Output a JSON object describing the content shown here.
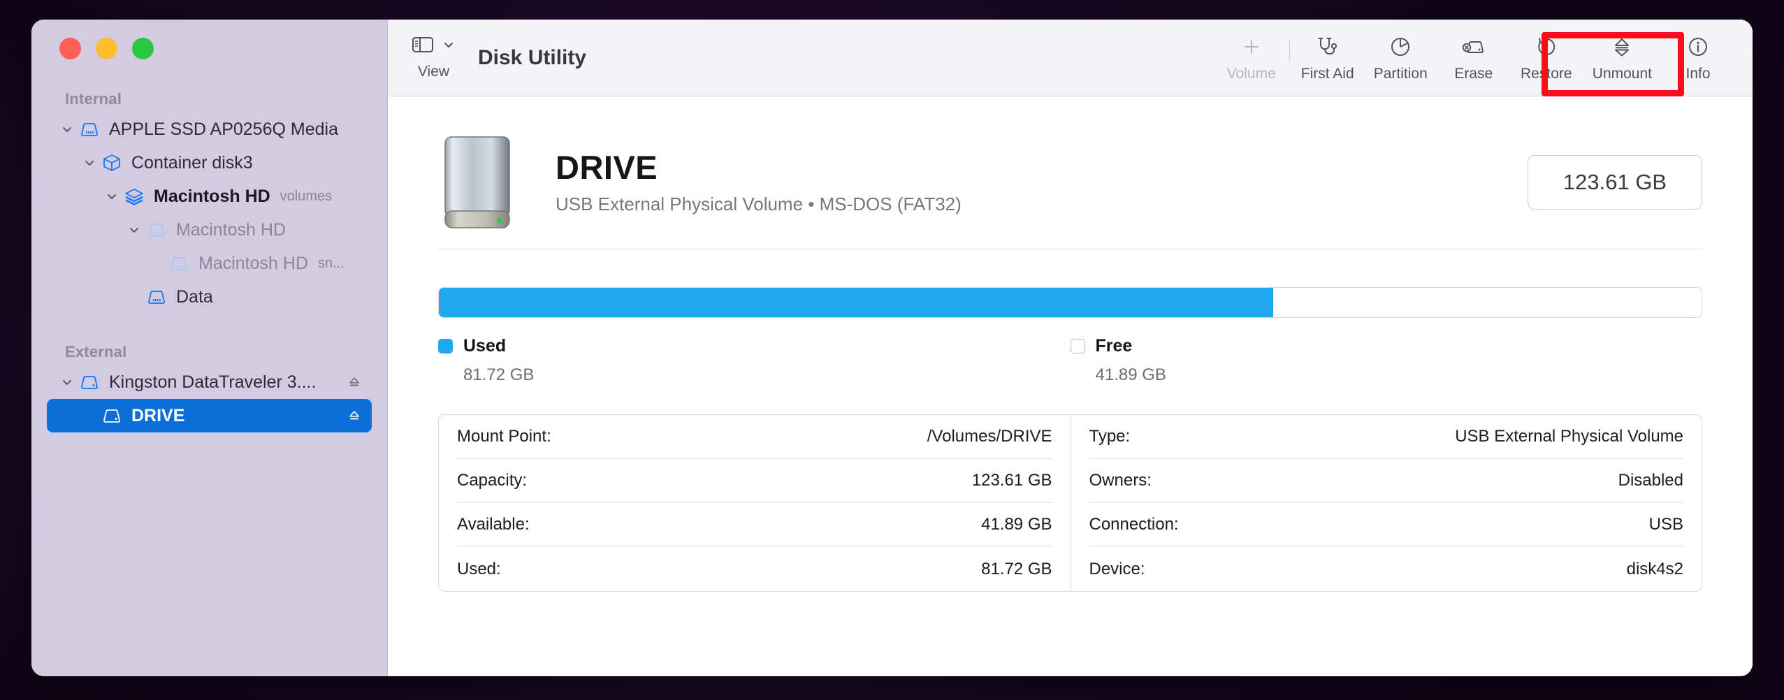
{
  "window": {
    "traffic_lights": [
      "close",
      "minimize",
      "zoom"
    ]
  },
  "sidebar": {
    "sections": [
      {
        "title": "Internal",
        "items": [
          {
            "label": "APPLE SSD AP0256Q Media",
            "sublabel": "",
            "icon": "drive-icon",
            "level": 0,
            "twisty": "chevron-down-icon",
            "style": "normal",
            "selected": false,
            "eject": false
          },
          {
            "label": "Container disk3",
            "sublabel": "",
            "icon": "container-box-icon",
            "level": 1,
            "twisty": "chevron-down-icon",
            "style": "normal",
            "selected": false,
            "eject": false
          },
          {
            "label": "Macintosh HD",
            "sublabel": "volumes",
            "icon": "volume-group-icon",
            "level": 2,
            "twisty": "chevron-down-icon",
            "style": "bold",
            "selected": false,
            "eject": false
          },
          {
            "label": "Macintosh HD",
            "sublabel": "",
            "icon": "drive-icon-dim",
            "level": 3,
            "twisty": "chevron-down-icon",
            "style": "dim",
            "selected": false,
            "eject": false
          },
          {
            "label": "Macintosh HD",
            "sublabel": "sn...",
            "icon": "drive-icon-dim",
            "level": 4,
            "twisty": "none",
            "style": "dim",
            "selected": false,
            "eject": false
          },
          {
            "label": "Data",
            "sublabel": "",
            "icon": "drive-icon",
            "level": 3,
            "twisty": "none",
            "style": "normal",
            "selected": false,
            "eject": false
          }
        ]
      },
      {
        "title": "External",
        "items": [
          {
            "label": "Kingston DataTraveler 3....",
            "sublabel": "",
            "icon": "drive-icon",
            "level": 0,
            "twisty": "chevron-down-icon",
            "style": "normal",
            "selected": false,
            "eject": true
          },
          {
            "label": "DRIVE",
            "sublabel": "",
            "icon": "drive-icon-white",
            "level": 1,
            "twisty": "none",
            "style": "selected",
            "selected": true,
            "eject": true
          }
        ]
      }
    ]
  },
  "toolbar": {
    "view_label": "View",
    "app_title": "Disk Utility",
    "buttons": [
      {
        "label": "Volume",
        "icon": "plus-icon",
        "disabled": true
      },
      {
        "label": "First Aid",
        "icon": "stethoscope-icon",
        "disabled": false
      },
      {
        "label": "Partition",
        "icon": "pie-chart-icon",
        "disabled": false
      },
      {
        "label": "Erase",
        "icon": "erase-drive-icon",
        "disabled": false
      },
      {
        "label": "Restore",
        "icon": "restore-arrow-icon",
        "disabled": false
      },
      {
        "label": "Unmount",
        "icon": "eject-icon",
        "disabled": false
      },
      {
        "label": "Info",
        "icon": "info-circle-icon",
        "disabled": false
      }
    ],
    "highlight_target": "First Aid",
    "highlight_color": "#fc0d1b"
  },
  "header": {
    "drive_name": "DRIVE",
    "description": "USB External Physical Volume • MS-DOS (FAT32)",
    "capacity_badge": "123.61 GB"
  },
  "usage": {
    "used_percent": 66.1,
    "legend": [
      {
        "name": "Used",
        "value": "81.72 GB",
        "color": "#21a7f0"
      },
      {
        "name": "Free",
        "value": "41.89 GB",
        "color": "#ffffff"
      }
    ]
  },
  "info": {
    "left": [
      {
        "key": "Mount Point:",
        "value": "/Volumes/DRIVE"
      },
      {
        "key": "Capacity:",
        "value": "123.61 GB"
      },
      {
        "key": "Available:",
        "value": "41.89 GB"
      },
      {
        "key": "Used:",
        "value": "81.72 GB"
      }
    ],
    "right": [
      {
        "key": "Type:",
        "value": "USB External Physical Volume"
      },
      {
        "key": "Owners:",
        "value": "Disabled"
      },
      {
        "key": "Connection:",
        "value": "USB"
      },
      {
        "key": "Device:",
        "value": "disk4s2"
      }
    ]
  }
}
